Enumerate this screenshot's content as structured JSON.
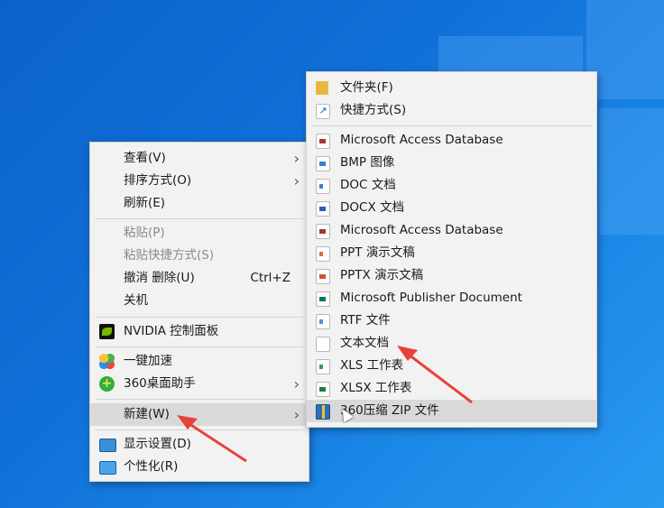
{
  "context_menu": {
    "items": [
      {
        "label": "查看(V)",
        "submenu": true
      },
      {
        "label": "排序方式(O)",
        "submenu": true
      },
      {
        "label": "刷新(E)"
      },
      {
        "label": "粘贴(P)",
        "disabled": true
      },
      {
        "label": "粘贴快捷方式(S)",
        "disabled": true
      },
      {
        "label": "撤消 删除(U)",
        "accel": "Ctrl+Z"
      },
      {
        "label": "关机"
      },
      {
        "label": "NVIDIA 控制面板",
        "icon": "nvidia-icon"
      },
      {
        "label": "一键加速",
        "icon": "speedup-icon"
      },
      {
        "label": "360桌面助手",
        "icon": "360-desktop-icon",
        "submenu": true
      },
      {
        "label": "新建(W)",
        "submenu": true,
        "highlighted": true
      },
      {
        "label": "显示设置(D)",
        "icon": "display-icon"
      },
      {
        "label": "个性化(R)",
        "icon": "personalize-icon"
      }
    ]
  },
  "new_submenu": {
    "items": [
      {
        "label": "文件夹(F)",
        "icon": "folder-icon"
      },
      {
        "label": "快捷方式(S)",
        "icon": "shortcut-icon"
      },
      {
        "label": "Microsoft Access Database",
        "icon": "access-icon"
      },
      {
        "label": "BMP 图像",
        "icon": "bmp-icon"
      },
      {
        "label": "DOC 文档",
        "icon": "doc-icon"
      },
      {
        "label": "DOCX 文档",
        "icon": "docx-icon"
      },
      {
        "label": "Microsoft Access Database",
        "icon": "access-icon"
      },
      {
        "label": "PPT 演示文稿",
        "icon": "ppt-icon"
      },
      {
        "label": "PPTX 演示文稿",
        "icon": "pptx-icon"
      },
      {
        "label": "Microsoft Publisher Document",
        "icon": "publisher-icon"
      },
      {
        "label": "RTF 文件",
        "icon": "rtf-icon"
      },
      {
        "label": "文本文档",
        "icon": "text-doc-icon"
      },
      {
        "label": "XLS 工作表",
        "icon": "xls-icon"
      },
      {
        "label": "XLSX 工作表",
        "icon": "xlsx-icon"
      },
      {
        "label": "360压缩 ZIP 文件",
        "icon": "zip-icon",
        "highlighted": true
      }
    ]
  },
  "colors": {
    "desktop": "#1170d8",
    "menu_bg": "#f2f2f2",
    "highlight": "#d9d9d9",
    "annotation_arrow": "#e8413a"
  }
}
